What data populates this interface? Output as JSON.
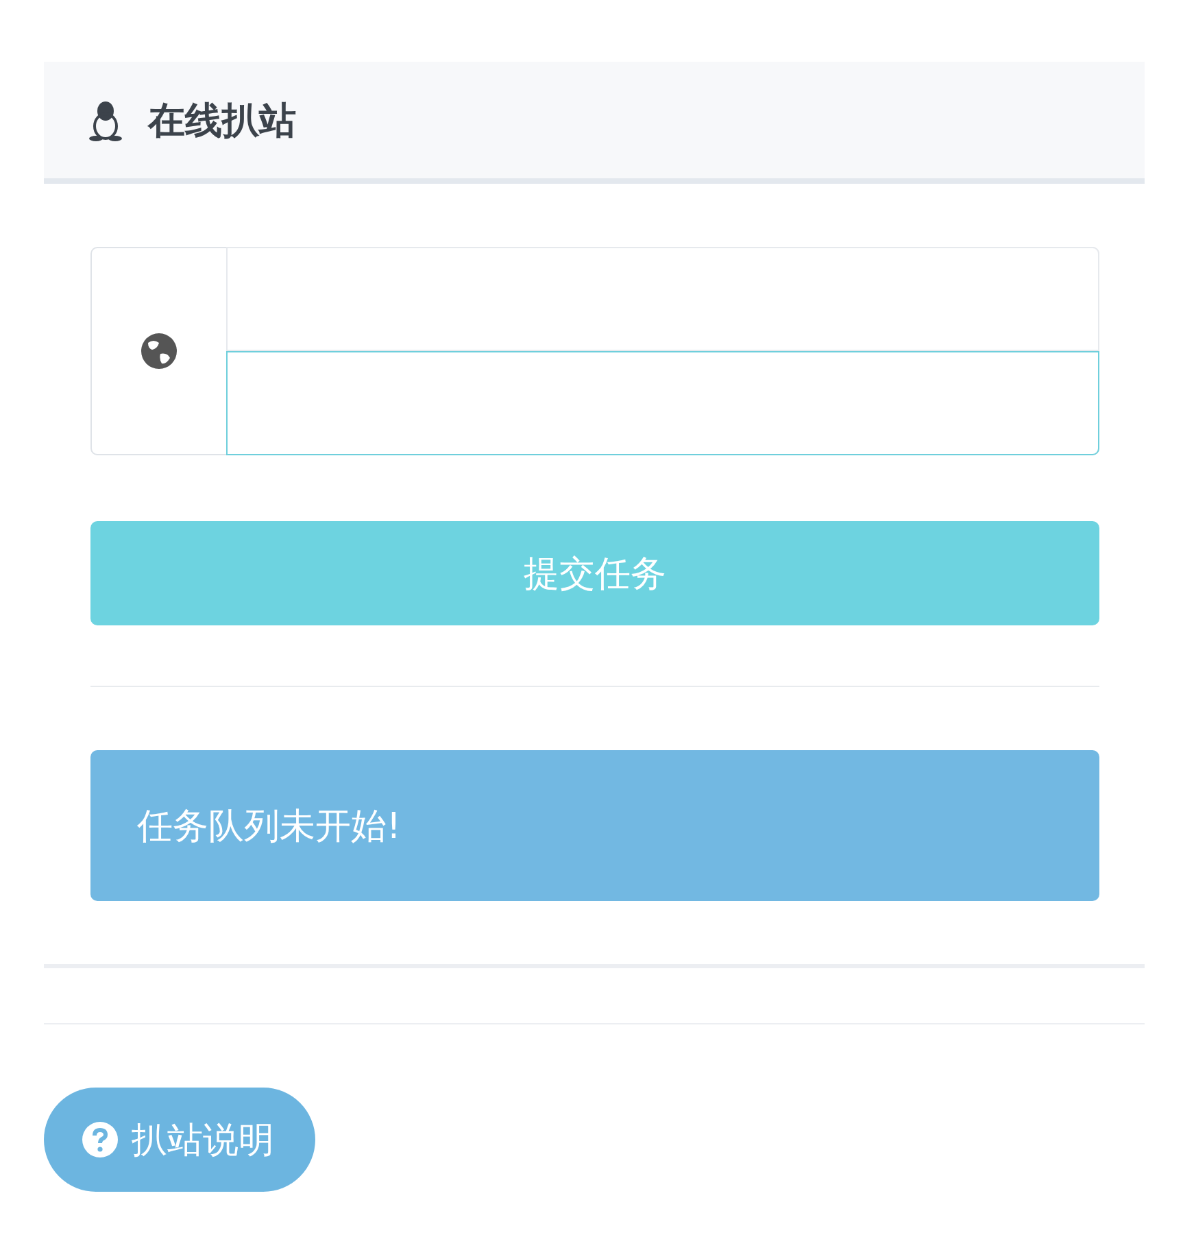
{
  "panel": {
    "title": "在线扒站"
  },
  "fields": [
    {
      "focused": false
    },
    {
      "focused": true
    }
  ],
  "submit_button": "提交任务",
  "alert": "任务队列未开始!",
  "help_button": "扒站说明"
}
